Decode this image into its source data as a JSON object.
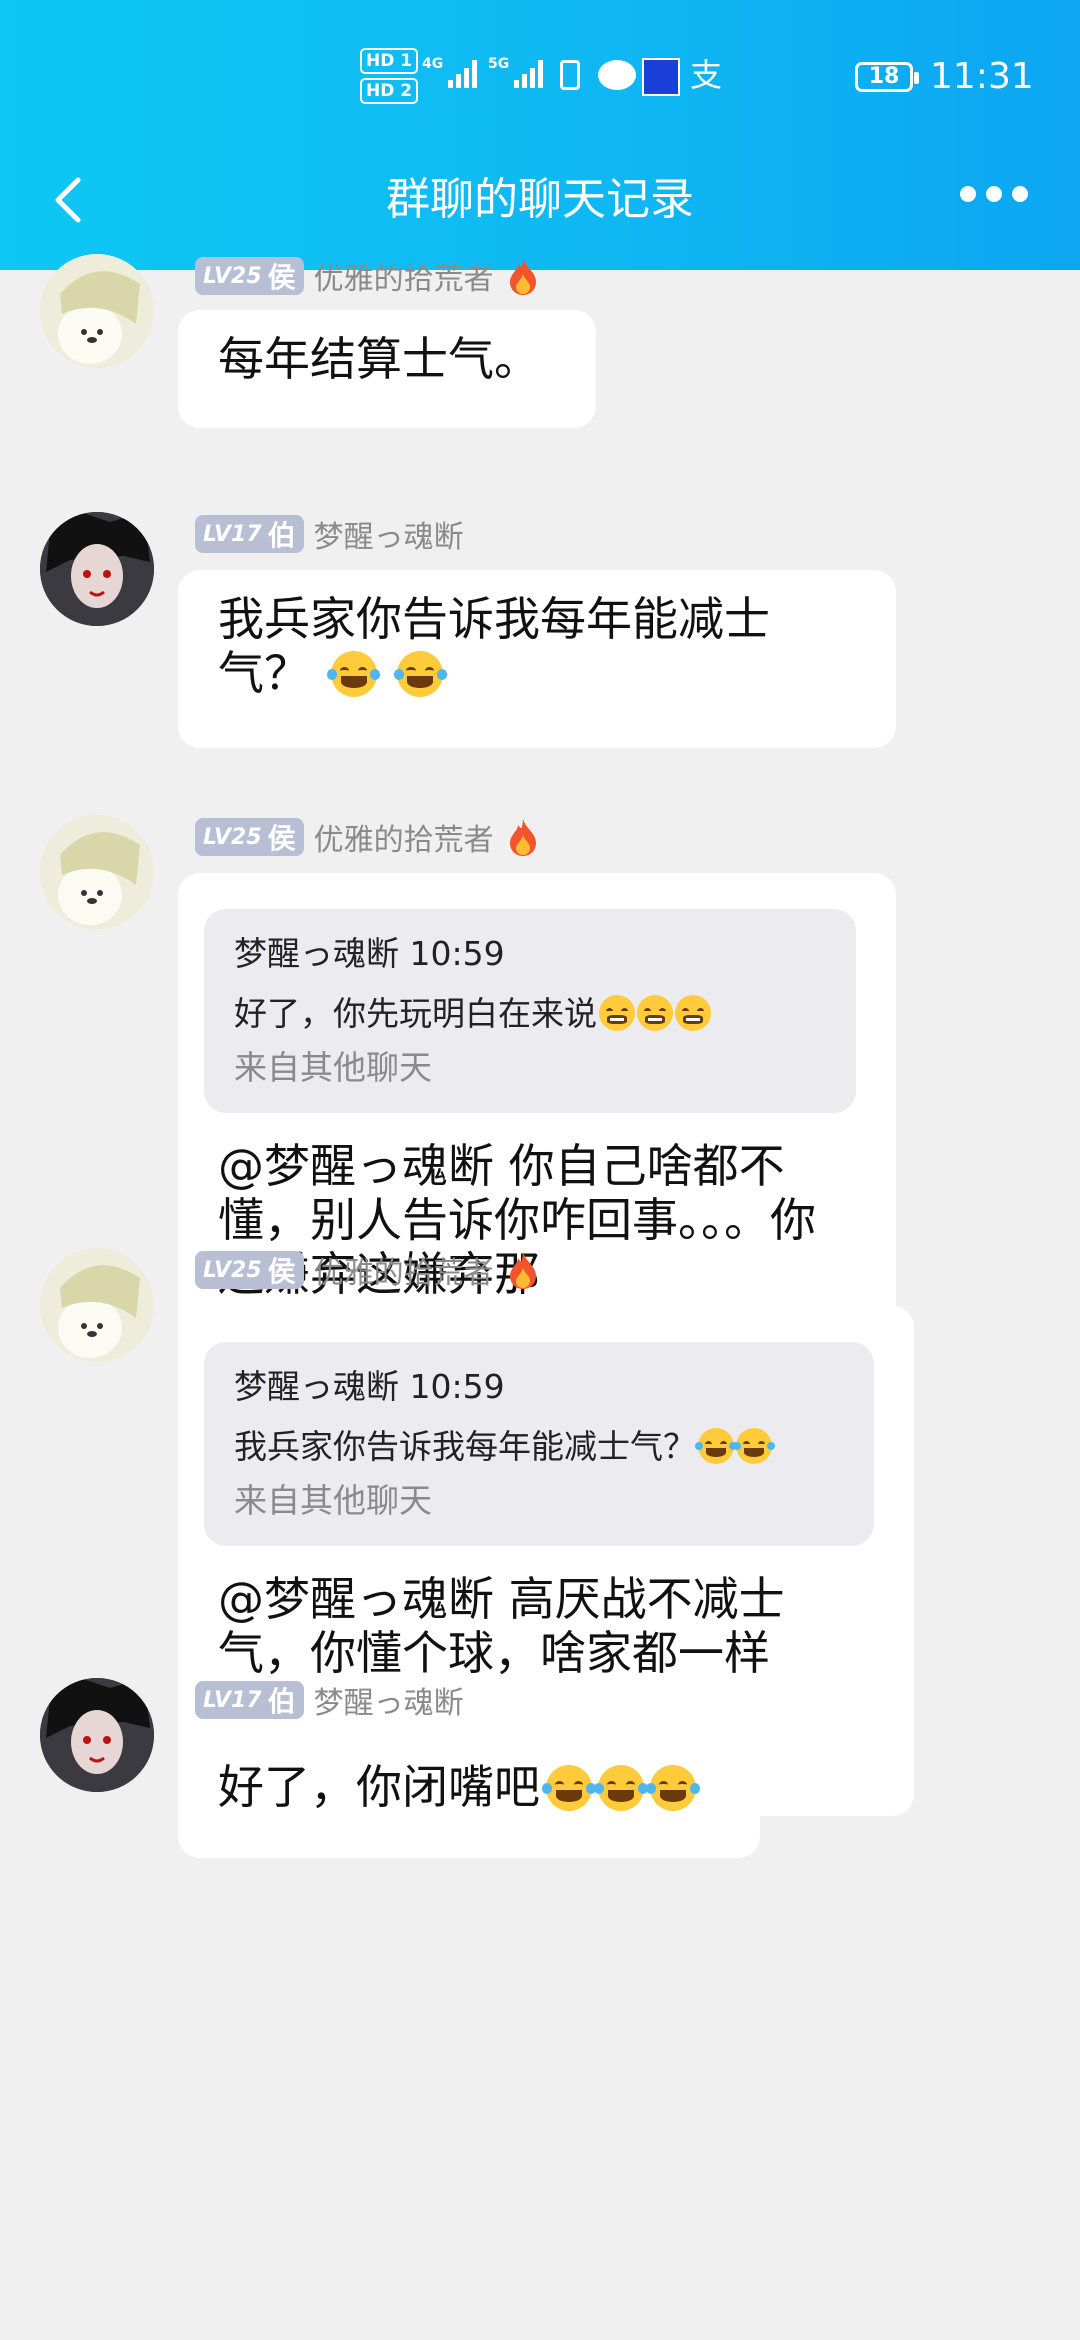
{
  "status_bar": {
    "hd1": "HD 1",
    "hd2": "HD 2",
    "net1": "4G",
    "net2": "5G",
    "pay": "支",
    "battery": "18",
    "time": "11:31"
  },
  "nav": {
    "title": "群聊的聊天记录"
  },
  "messages": [
    {
      "level": "LV25",
      "rank": "侯",
      "nick": "优雅的拾荒者",
      "text": "每年结算士气。"
    },
    {
      "level": "LV17",
      "rank": "伯",
      "nick": "梦醒っ魂断",
      "text": "我兵家你告诉我每年能减士气？"
    },
    {
      "level": "LV25",
      "rank": "侯",
      "nick": "优雅的拾荒者",
      "quote": {
        "head": "梦醒っ魂断 10:59",
        "text": "好了，你先玩明白在来说",
        "source": "来自其他聊天"
      },
      "text": "@梦醒っ魂断 你自己啥都不懂，别人告诉你咋回事。。。你还嫌弃这嫌弃那"
    },
    {
      "level": "LV25",
      "rank": "侯",
      "nick": "优雅的拾荒者",
      "quote": {
        "head": "梦醒っ魂断 10:59",
        "text": "我兵家你告诉我每年能减士气？",
        "source": "来自其他聊天"
      },
      "text": "@梦醒っ魂断 高厌战不减士气，你懂个球，啥家都一样"
    },
    {
      "level": "LV17",
      "rank": "伯",
      "nick": "梦醒っ魂断",
      "text": "好了，你闭嘴吧"
    }
  ],
  "icons": [
    "back-arrow-icon",
    "more-dots-icon",
    "fire-icon",
    "laugh-cry-emoji",
    "grin-emoji"
  ]
}
